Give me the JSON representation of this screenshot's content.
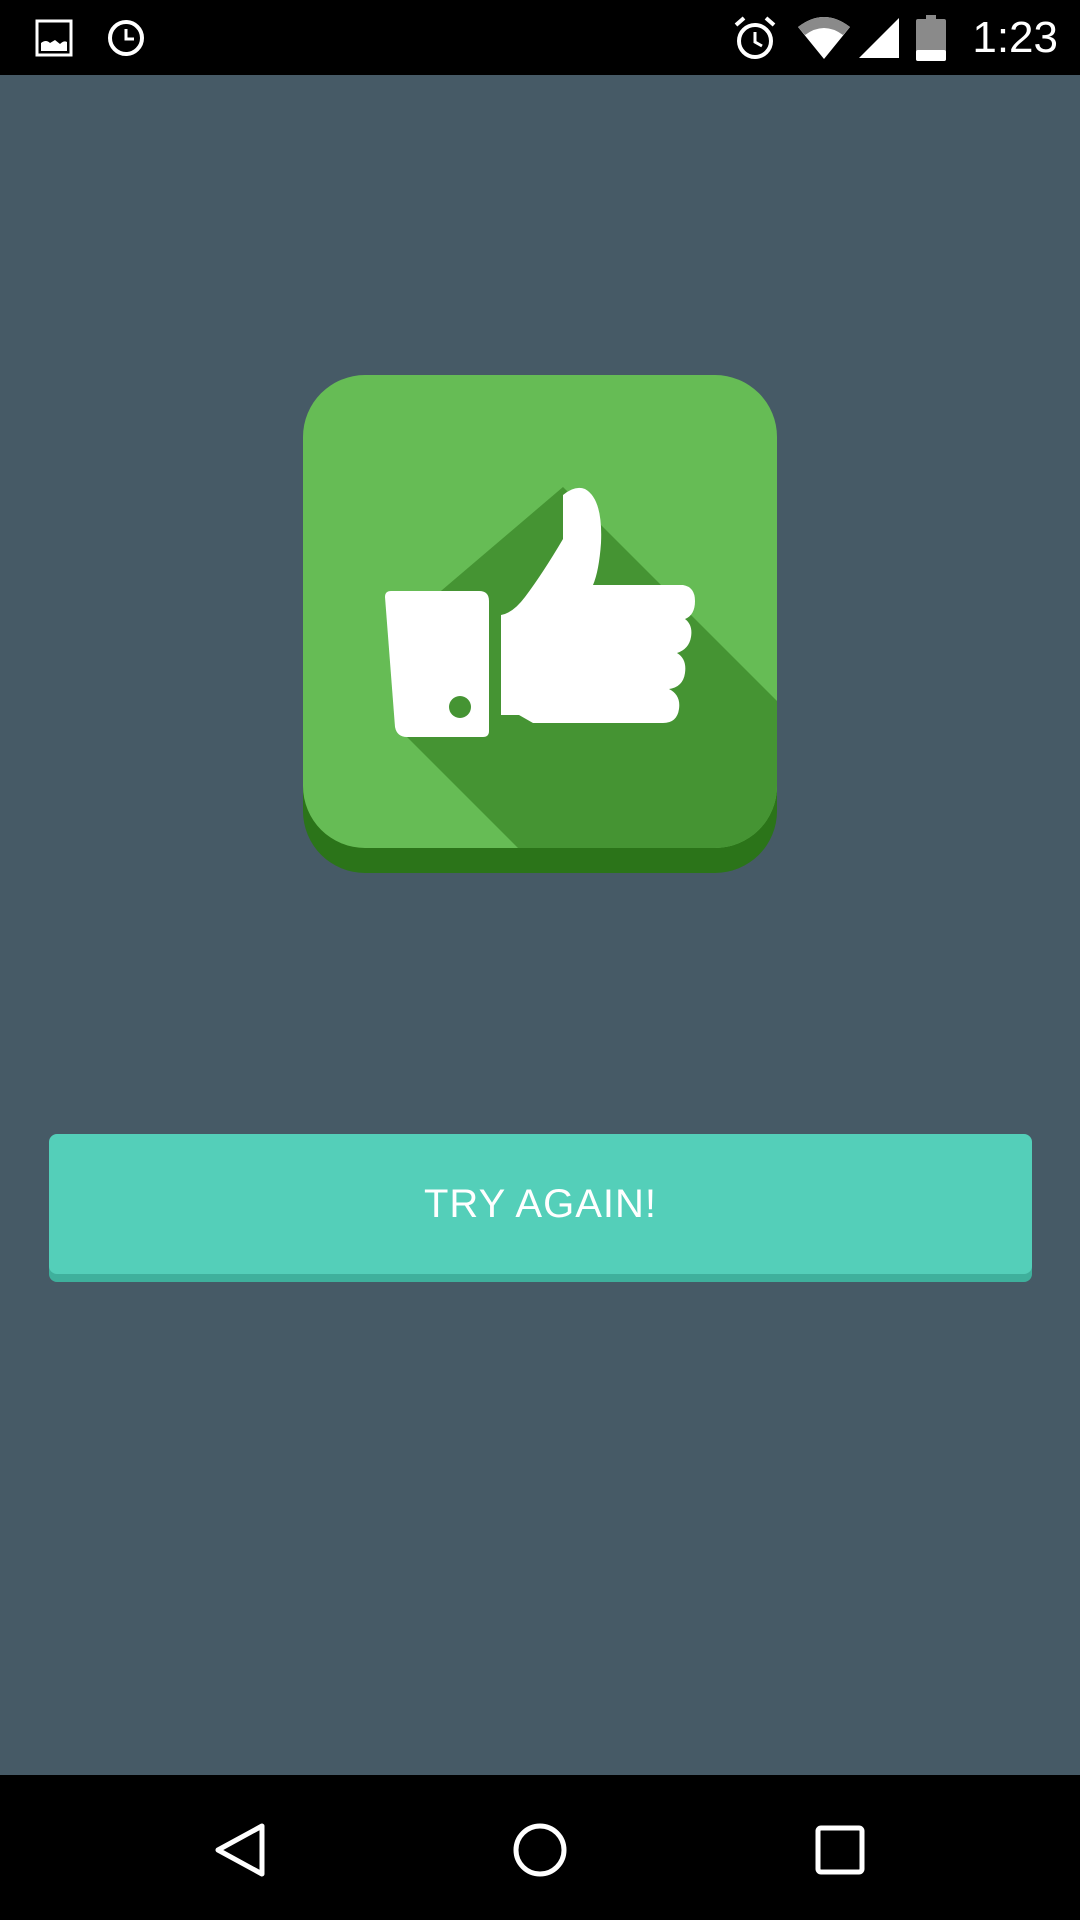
{
  "status_bar": {
    "time": "1:23",
    "left_icons": [
      "image-icon",
      "clock-icon"
    ],
    "right_icons": [
      "alarm-icon",
      "wifi-icon",
      "cell-signal-icon",
      "battery-icon"
    ]
  },
  "result": {
    "icon": "thumbs-up-icon",
    "badge_color": "#66bc55",
    "badge_shadow_color": "#2b7419",
    "badge_long_shadow_color": "#459433"
  },
  "actions": {
    "try_again_label": "TRY AGAIN!",
    "button_color": "#54cfb9"
  },
  "nav_bar": {
    "buttons": [
      "back-icon",
      "home-icon",
      "recents-icon"
    ]
  },
  "colors": {
    "background": "#465a66"
  }
}
